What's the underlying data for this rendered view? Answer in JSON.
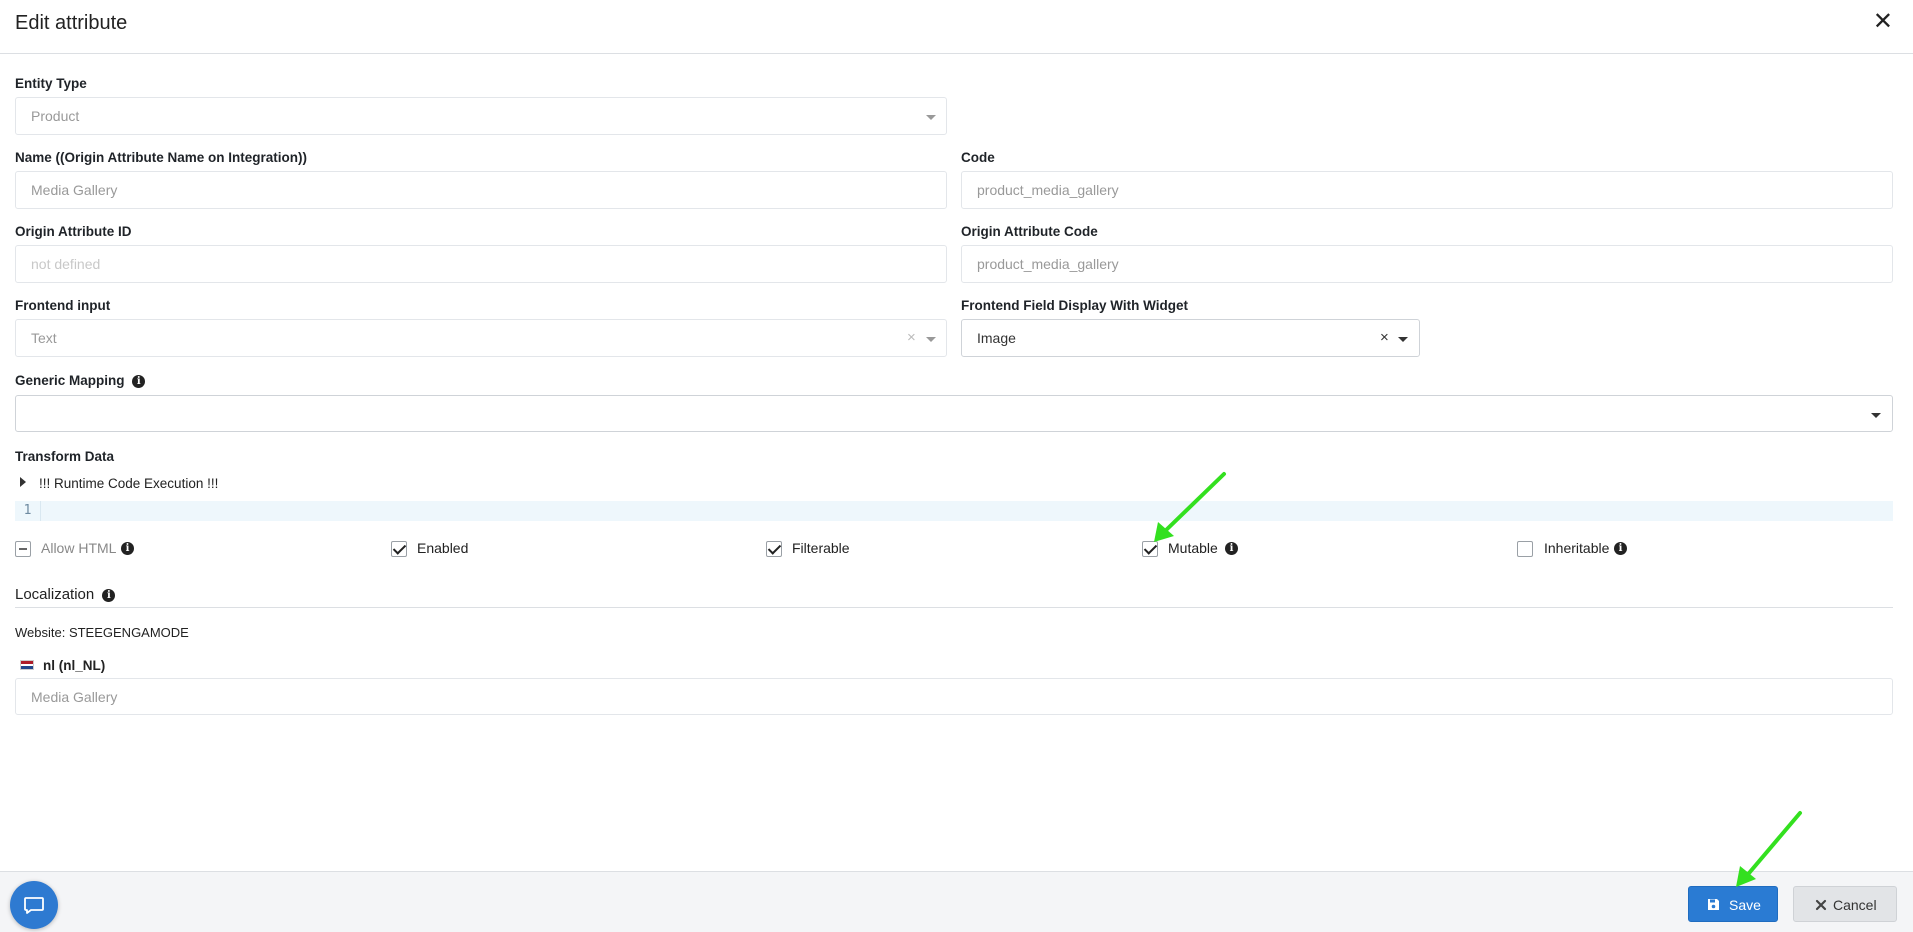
{
  "modal": {
    "title": "Edit attribute",
    "close_symbol": "✕"
  },
  "entity_type": {
    "label": "Entity Type",
    "value": "Product"
  },
  "name": {
    "label": "Name ((Origin Attribute Name on Integration))",
    "value": "Media Gallery"
  },
  "code": {
    "label": "Code",
    "value": "product_media_gallery"
  },
  "origin_attribute_id": {
    "label": "Origin Attribute ID",
    "placeholder": "not defined"
  },
  "origin_attribute_code": {
    "label": "Origin Attribute Code",
    "value": "product_media_gallery"
  },
  "frontend_input": {
    "label": "Frontend input",
    "value": "Text",
    "clear_symbol": "×"
  },
  "frontend_widget": {
    "label": "Frontend Field Display With Widget",
    "value": "Image",
    "clear_symbol": "×"
  },
  "generic_mapping": {
    "label": "Generic Mapping",
    "value": "",
    "info_icon": "info-circle-icon"
  },
  "transform_data": {
    "label": "Transform Data",
    "tree_node": "!!! Runtime Code Execution !!!",
    "line_number": "1"
  },
  "flags": [
    {
      "key": "allow_html",
      "label": "Allow HTML",
      "state": "indeterminate",
      "info": true
    },
    {
      "key": "enabled",
      "label": "Enabled",
      "state": "checked",
      "info": false
    },
    {
      "key": "filterable",
      "label": "Filterable",
      "state": "checked",
      "info": false
    },
    {
      "key": "mutable",
      "label": "Mutable",
      "state": "checked",
      "info": true
    },
    {
      "key": "inheritable",
      "label": "Inheritable",
      "state": "unchecked",
      "info": true
    }
  ],
  "localization": {
    "title": "Localization",
    "website": "Website: STEEGENGAMODE",
    "locale": "nl (nl_NL)",
    "flag_colors": [
      "#ae1c28",
      "#ffffff",
      "#21468b"
    ],
    "value": "Media Gallery"
  },
  "footer": {
    "save_label": "Save",
    "cancel_label": "Cancel"
  },
  "colors": {
    "primary": "#2a7bd3",
    "annotation_arrow": "#33e01f"
  }
}
